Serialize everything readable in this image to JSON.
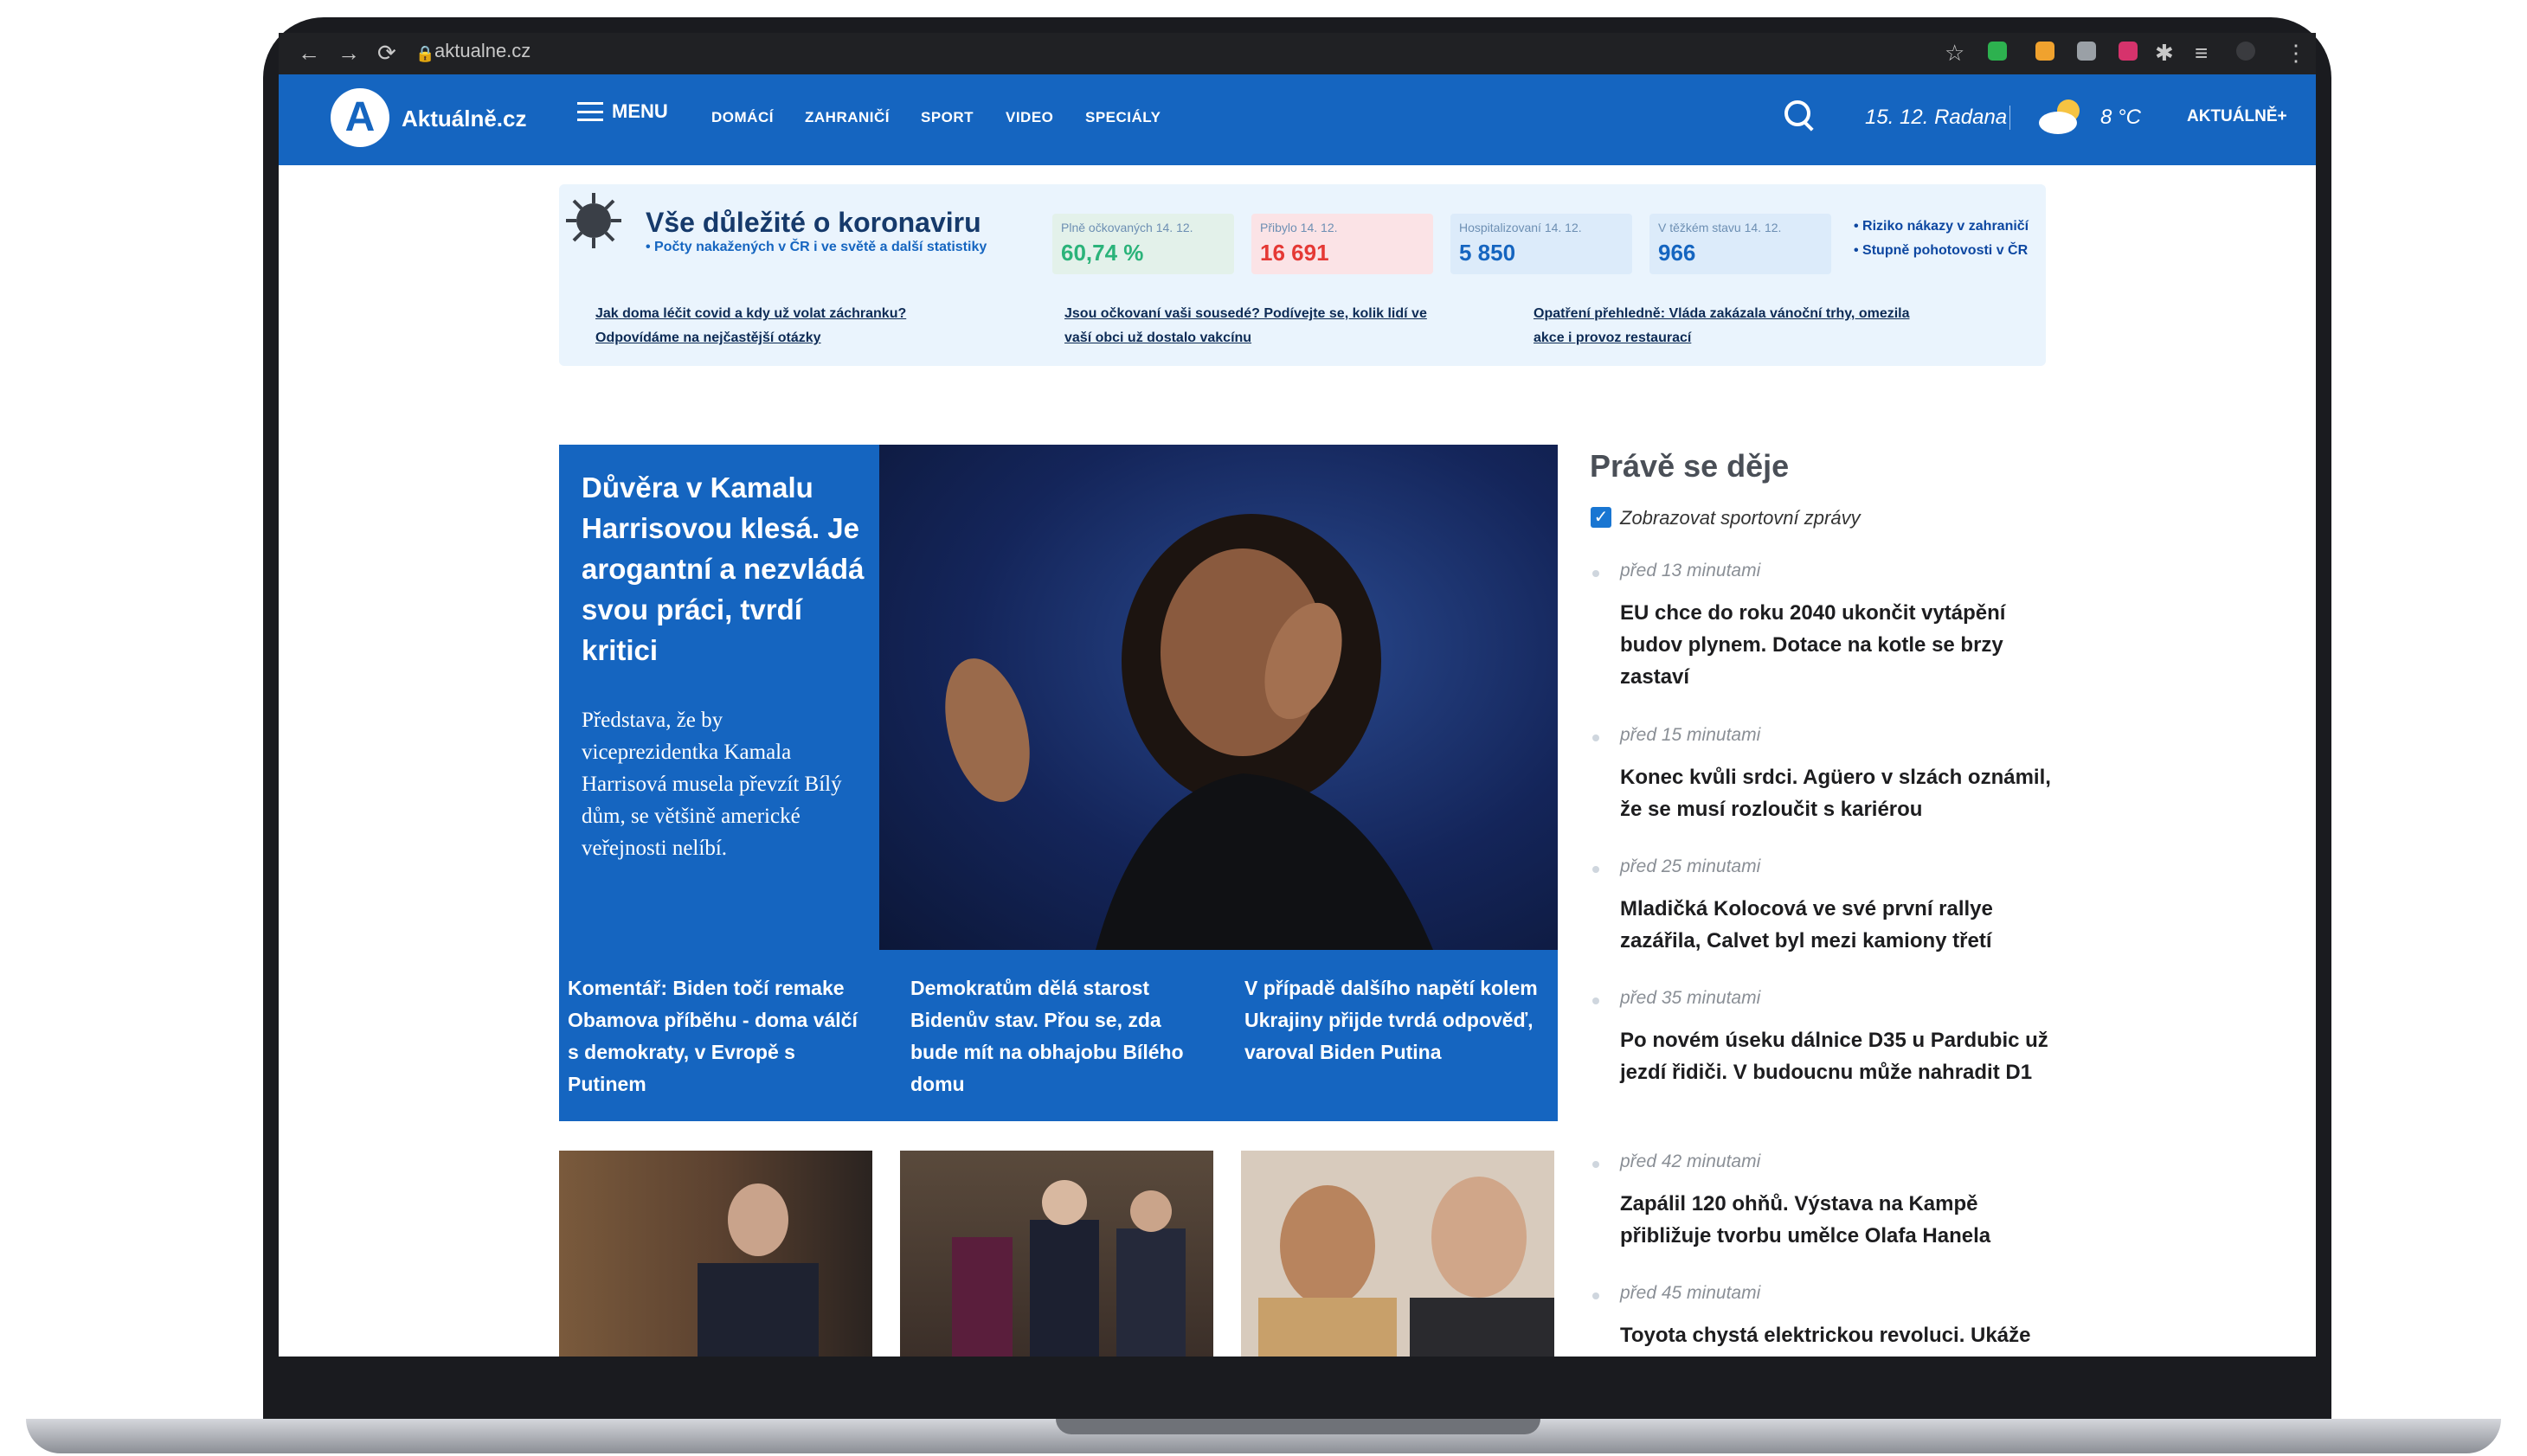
{
  "browser": {
    "url": "aktualne.cz",
    "nav_icons": [
      "back-icon",
      "forward-icon",
      "reload-icon"
    ]
  },
  "header": {
    "logo_letter": "A",
    "logo_text": "Aktuálně.cz",
    "menu_label": "MENU",
    "nav": [
      "DOMÁCÍ",
      "ZAHRANIČÍ",
      "SPORT",
      "VIDEO",
      "SPECIÁLY"
    ],
    "date": "15. 12.",
    "nameday": "Radana",
    "temperature": "8 °C",
    "aktualne_label": "AKTUÁLNĚ+",
    "brand_color": "#1565c0"
  },
  "covid": {
    "title": "Vše důležité o koronaviru",
    "subtitle": "• Počty nakažených v ČR i ve světě a další statistiky",
    "stats": [
      {
        "label": "Plně očkovaných 14. 12.",
        "value": "60,74 %",
        "color": "#2bb37a"
      },
      {
        "label": "Přibylo 14. 12.",
        "value": "16 691",
        "color": "#e53935"
      },
      {
        "label": "Hospitalizovaní 14. 12.",
        "value": "5 850",
        "color": "#1565c0"
      },
      {
        "label": "V těžkém stavu 14. 12.",
        "value": "966",
        "color": "#1565c0"
      }
    ],
    "side_links": [
      "• Riziko nákazy v zahraničí",
      "• Stupně pohotovosti v ČR"
    ],
    "links": [
      {
        "line1": "Jak doma léčit covid a kdy už volat záchranku?",
        "line2": "Odpovídáme na nejčastější otázky"
      },
      {
        "line1": "Jsou očkovaní vaši sousedé? Podívejte se, kolik lidí ve",
        "line2": "vaší obci už dostalo vakcínu"
      },
      {
        "line1": "Opatření přehledně: Vláda zakázala vánoční trhy, omezila",
        "line2": "akce i provoz restaurací"
      }
    ]
  },
  "hero": {
    "title": "Důvěra v Kamalu Harrisovou klesá. Je arogantní a nezvládá svou práci, tvrdí kritici",
    "perex": "Představa, že by viceprezidentka Kamala Harrisová musela převzít Bílý dům, se většině americké veřejnosti nelíbí.",
    "related": [
      "Komentář: Biden točí remake Obamova příběhu - doma válčí s demokraty, v Evropě s Putinem",
      "Demokratům dělá starost Bidenův stav. Přou se, zda bude mít na obhajobu Bílého domu",
      "V případě dalšího napětí kolem Ukrajiny přijde tvrdá odpověď, varoval Biden Putina"
    ]
  },
  "live": {
    "title": "Právě se děje",
    "checkbox_label": "Zobrazovat sportovní zprávy",
    "checkbox_checked": true,
    "items": [
      {
        "time": "před 13 minutami",
        "text": "EU chce do roku 2040 ukončit vytápění budov plynem. Dotace na kotle se brzy zastaví"
      },
      {
        "time": "před 15 minutami",
        "text": "Konec kvůli srdci. Agüero v slzách oznámil, že se musí rozloučit s kariérou"
      },
      {
        "time": "před 25 minutami",
        "text": "Mladičká Kolocová ve své první rallye zazářila, Calvet byl mezi kamiony třetí"
      },
      {
        "time": "před 35 minutami",
        "text": "Po novém úseku dálnice D35 u Pardubic už jezdí řidiči. V budoucnu může nahradit D1"
      },
      {
        "time": "před 42 minutami",
        "text": "Zapálil 120 ohňů. Výstava na Kampě přibližuje tvorbu umělce Olafa Hanela"
      },
      {
        "time": "před 45 minutami",
        "text": "Toyota chystá elektrickou revoluci. Ukáže"
      }
    ]
  }
}
